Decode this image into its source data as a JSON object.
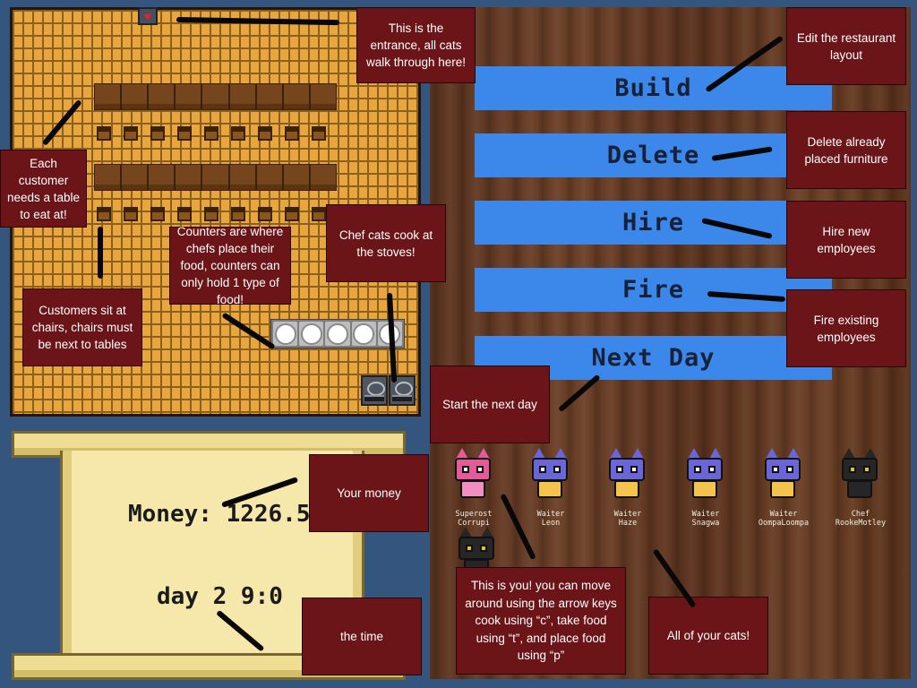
{
  "toolbar": {
    "build_label": "Build",
    "delete_label": "Delete",
    "hire_label": "Hire",
    "fire_label": "Fire",
    "next_day_label": "Next Day"
  },
  "status": {
    "money_text": "Money: 1226.5",
    "day_time_text": "day 2 9:0"
  },
  "callouts": {
    "entrance": "This is the entrance, all cats walk through here!",
    "tables": "Each customer needs a table to eat at!",
    "chairs": "Customers sit at chairs, chairs must be next to tables",
    "counters": "Counters are where chefs place their food, counters can only hold 1 type of food!",
    "stoves": "Chef cats cook at the stoves!",
    "build": "Edit the restaurant layout",
    "delete": "Delete already placed furniture",
    "hire": "Hire new employees",
    "fire": "Fire existing employees",
    "next_day": "Start the next day",
    "money": "Your money",
    "time": "the time",
    "player": "This is you! you can move around using the arrow keys cook using “c”, take food using “t”, and place food using “p”",
    "cats": "All of your cats!"
  },
  "cats": [
    {
      "role": "Superost",
      "name": "Corrupi",
      "icon": "pink-cat-icon",
      "fur": "#e45b97",
      "eye": "#ffffff",
      "body": "#f08fc0"
    },
    {
      "role": "Waiter",
      "name": "Leon",
      "icon": "blue-cat-icon",
      "fur": "#6a66d8",
      "eye": "#ffffff",
      "body": "#f3c34e"
    },
    {
      "role": "Waiter",
      "name": "Haze",
      "icon": "blue-cat-icon",
      "fur": "#6a66d8",
      "eye": "#ffffff",
      "body": "#f3c34e"
    },
    {
      "role": "Waiter",
      "name": "Snagwa",
      "icon": "blue-cat-icon",
      "fur": "#6a66d8",
      "eye": "#ffffff",
      "body": "#f3c34e"
    },
    {
      "role": "Waiter",
      "name": "OompaLoompa",
      "icon": "blue-cat-icon",
      "fur": "#6a66d8",
      "eye": "#ffffff",
      "body": "#f3c34e"
    },
    {
      "role": "Chef",
      "name": "RookeMotley",
      "icon": "black-cat-icon",
      "fur": "#262626",
      "eye": "#d6c33b",
      "body": "#262626"
    }
  ],
  "colors": {
    "button_blue": "#3c87ea",
    "callout_red": "#6b1518",
    "floor_orange": "#e8a63f",
    "background_blue": "#34557e"
  }
}
